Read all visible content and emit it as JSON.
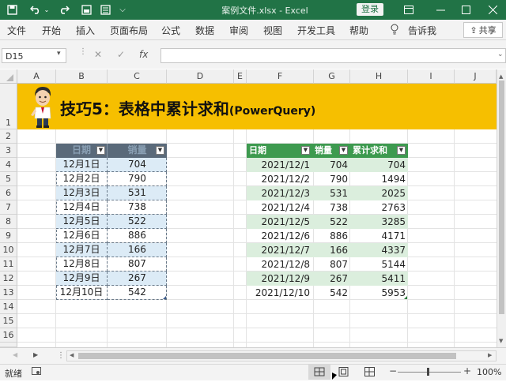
{
  "titlebar": {
    "doc_title": "案例文件.xlsx  -  Excel",
    "login": "登录",
    "icons": [
      "save-icon",
      "undo-icon",
      "undo-dropdown-icon",
      "redo-icon",
      "view-icon",
      "form-icon",
      "customize-icon"
    ]
  },
  "tabs": [
    "文件",
    "开始",
    "插入",
    "页面布局",
    "公式",
    "数据",
    "审阅",
    "视图",
    "开发工具",
    "帮助"
  ],
  "tell_me": "告诉我",
  "share": "共享",
  "formula": {
    "name_box": "D15",
    "value": ""
  },
  "columns": [
    "A",
    "B",
    "C",
    "D",
    "E",
    "F",
    "G",
    "H",
    "I",
    "J"
  ],
  "rows": [
    "1",
    "2",
    "3",
    "4",
    "5",
    "6",
    "7",
    "8",
    "9",
    "10",
    "11",
    "12",
    "13",
    "14",
    "15",
    "16"
  ],
  "banner": {
    "title": "技巧5：表格中累计求和",
    "subtitle": "(PowerQuery)"
  },
  "left_table": {
    "headers": [
      "日期",
      "销量"
    ],
    "rows": [
      [
        "12月1日",
        "704"
      ],
      [
        "12月2日",
        "790"
      ],
      [
        "12月3日",
        "531"
      ],
      [
        "12月4日",
        "738"
      ],
      [
        "12月5日",
        "522"
      ],
      [
        "12月6日",
        "886"
      ],
      [
        "12月7日",
        "166"
      ],
      [
        "12月8日",
        "807"
      ],
      [
        "12月9日",
        "267"
      ],
      [
        "12月10日",
        "542"
      ]
    ]
  },
  "right_table": {
    "headers": [
      "日期",
      "销量",
      "累计求和"
    ],
    "rows": [
      [
        "2021/12/1",
        "704",
        "704"
      ],
      [
        "2021/12/2",
        "790",
        "1494"
      ],
      [
        "2021/12/3",
        "531",
        "2025"
      ],
      [
        "2021/12/4",
        "738",
        "2763"
      ],
      [
        "2021/12/5",
        "522",
        "3285"
      ],
      [
        "2021/12/6",
        "886",
        "4171"
      ],
      [
        "2021/12/7",
        "166",
        "4337"
      ],
      [
        "2021/12/8",
        "807",
        "5144"
      ],
      [
        "2021/12/9",
        "267",
        "5411"
      ],
      [
        "2021/12/10",
        "542",
        "5953"
      ]
    ]
  },
  "status": {
    "ready": "就绪",
    "zoom": "100%"
  },
  "colors": {
    "excel_green": "#217346",
    "banner": "#f6bf00",
    "right_header": "#3d9a4f",
    "band_light": "#dbeedd",
    "left_band": "#dcebf6"
  }
}
